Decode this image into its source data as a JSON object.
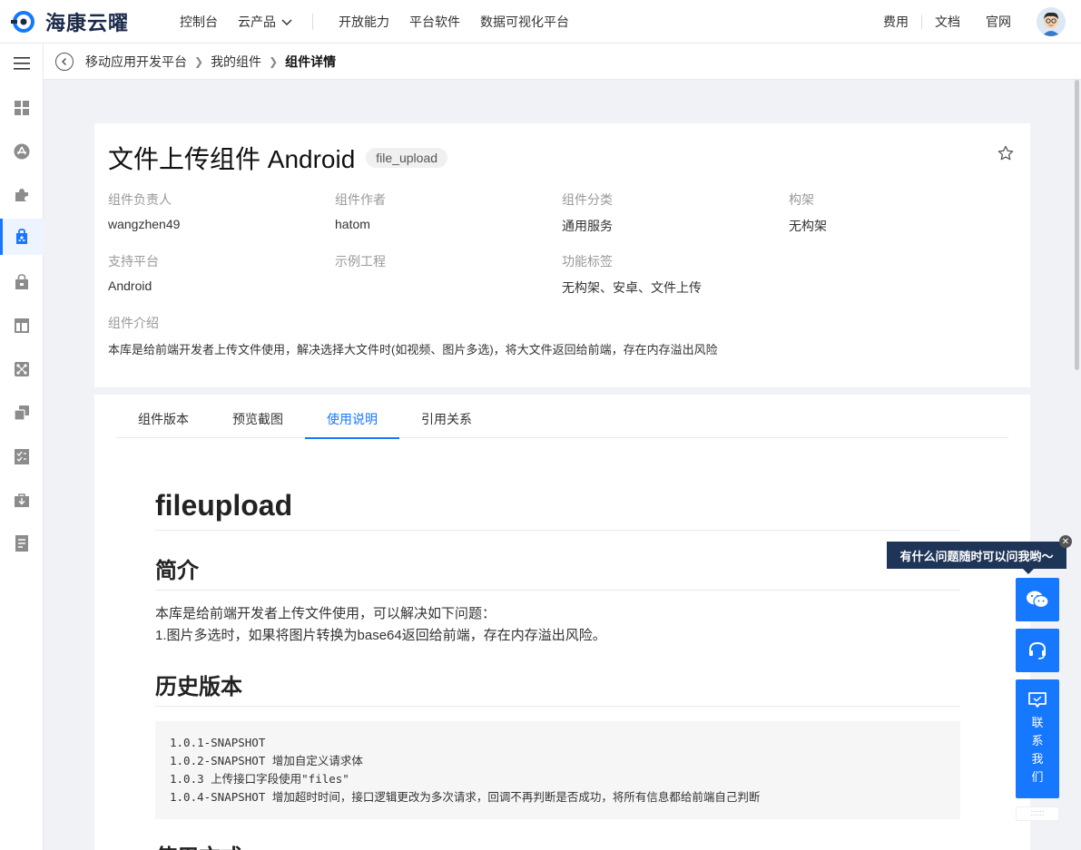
{
  "header": {
    "brand": "海康云曜",
    "nav": [
      {
        "label": "控制台"
      },
      {
        "label": "云产品"
      },
      {
        "label": "开放能力"
      },
      {
        "label": "平台软件"
      },
      {
        "label": "数据可视化平台"
      }
    ],
    "right": [
      {
        "label": "费用"
      },
      {
        "label": "文档"
      },
      {
        "label": "官网"
      }
    ]
  },
  "breadcrumb": [
    "移动应用开发平台",
    "我的组件",
    "组件详情"
  ],
  "component": {
    "title": "文件上传组件 Android",
    "tag": "file_upload",
    "fields": [
      {
        "label": "组件负责人",
        "value": "wangzhen49"
      },
      {
        "label": "组件作者",
        "value": "hatom"
      },
      {
        "label": "组件分类",
        "value": "通用服务"
      },
      {
        "label": "构架",
        "value": "无构架"
      },
      {
        "label": "支持平台",
        "value": "Android"
      },
      {
        "label": "示例工程",
        "value": ""
      },
      {
        "label": "功能标签",
        "value": "无构架、安卓、文件上传"
      }
    ],
    "desc_label": "组件介绍",
    "desc": "本库是给前端开发者上传文件使用，解决选择大文件时(如视频、图片多选)，将大文件返回给前端，存在内存溢出风险"
  },
  "tabs": [
    {
      "label": "组件版本"
    },
    {
      "label": "预览截图"
    },
    {
      "label": "使用说明",
      "active": true
    },
    {
      "label": "引用关系"
    }
  ],
  "doc": {
    "h1": "fileupload",
    "intro_h": "简介",
    "intro_p1": "本库是给前端开发者上传文件使用，可以解决如下问题：",
    "intro_p2": "1.图片多选时，如果将图片转换为base64返回给前端，存在内存溢出风险。",
    "history_h": "历史版本",
    "history": [
      "1.0.1-SNAPSHOT",
      "1.0.2-SNAPSHOT 增加自定义请求体",
      "1.0.3 上传接口字段使用\"files\"",
      "1.0.4-SNAPSHOT 增加超时时间，接口逻辑更改为多次请求，回调不再判断是否成功，将所有信息都给前端自己判断"
    ],
    "next_h": "使用方式"
  },
  "help": {
    "tooltip": "有什么问题随时可以问我哟～",
    "contact": "联系我们"
  },
  "colors": {
    "accent": "#1677ff",
    "tooltip_bg": "#1e3558"
  }
}
